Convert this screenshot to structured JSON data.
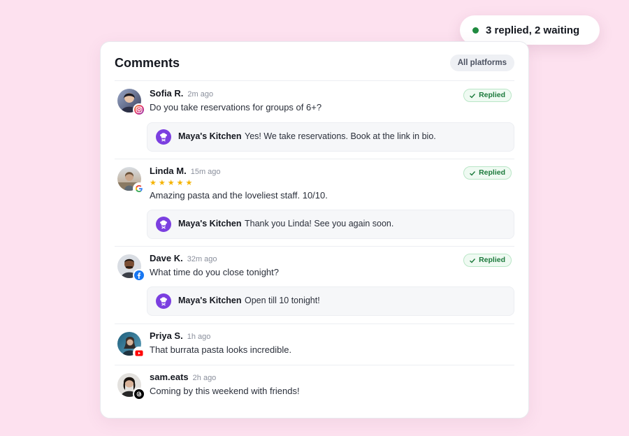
{
  "status": {
    "text": "3 replied, 2 waiting",
    "dot_color": "#1f8a3f"
  },
  "header": {
    "title": "Comments",
    "filter_label": "All platforms"
  },
  "brand": {
    "name": "Maya's Kitchen",
    "avatar_icon": "chef-icon",
    "accent": "#7b3fe0"
  },
  "replied_label": "Replied",
  "comments": [
    {
      "author": "Sofia R.",
      "time": "2m ago",
      "platform": "instagram",
      "text": "Do you take reservations for groups of 6+?",
      "status": "replied",
      "reply": "Yes! We take reservations. Book at the link in bio."
    },
    {
      "author": "Linda M.",
      "time": "15m ago",
      "platform": "google",
      "rating": 5,
      "stars": "★★★★★",
      "text": "Amazing pasta and the loveliest staff. 10/10.",
      "status": "replied",
      "reply": "Thank you Linda! See you again soon."
    },
    {
      "author": "Dave K.",
      "time": "32m ago",
      "platform": "facebook",
      "text": "What time do you close tonight?",
      "status": "replied",
      "reply": "Open till 10 tonight!"
    },
    {
      "author": "Priya S.",
      "time": "1h ago",
      "platform": "youtube",
      "text": "That burrata pasta looks incredible.",
      "status": "waiting"
    },
    {
      "author": "sam.eats",
      "time": "2h ago",
      "platform": "threads",
      "text": "Coming by this weekend with friends!",
      "status": "waiting"
    }
  ]
}
